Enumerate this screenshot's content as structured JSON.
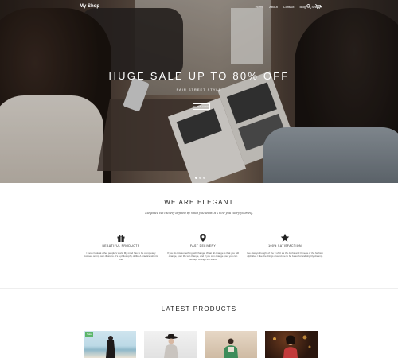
{
  "navbar": {
    "brand": "My Shop",
    "items": [
      "Home",
      "About",
      "Contact",
      "Blog",
      "Shop ▾"
    ],
    "icons": [
      "search-icon",
      "cart-icon"
    ]
  },
  "hero": {
    "title": "HUGE SALE UP TO 80% OFF",
    "subtitle": "PAIR STREET STYLE",
    "button": "SHOP NOW",
    "slides": 3,
    "active_slide": 1
  },
  "about": {
    "title": "WE ARE ELEGANT",
    "subtitle": "Elegance isn't solely defined by what you wear. It's how you carry yourself."
  },
  "features": [
    {
      "icon": "gift-icon",
      "title": "BEAUTIFUL PRODUCTS",
      "text": "I never look at other people's work. My mind has to be completely focused on my own illusions. It's a philosophy of life. A practice with its end."
    },
    {
      "icon": "location-pin-icon",
      "title": "FAST DELIVERY",
      "text": "If you do this something will change. What all change is that you will change, your life will change, and if you can change you, you can perhaps change the world."
    },
    {
      "icon": "star-icon",
      "title": "100% SATISFACTION",
      "text": "I've always thought of the T-shirt as the Alpha and Omega of the fashion alphabet. I like the things around me to be beautiful and slightly dreamy."
    }
  ],
  "latest": {
    "title": "LATEST PRODUCTS",
    "products": [
      {
        "badge": "Sale"
      },
      {
        "badge": ""
      },
      {
        "badge": ""
      },
      {
        "badge": ""
      }
    ]
  },
  "colors": {
    "sale_badge": "#5bb56a",
    "text_dark": "#222222"
  }
}
